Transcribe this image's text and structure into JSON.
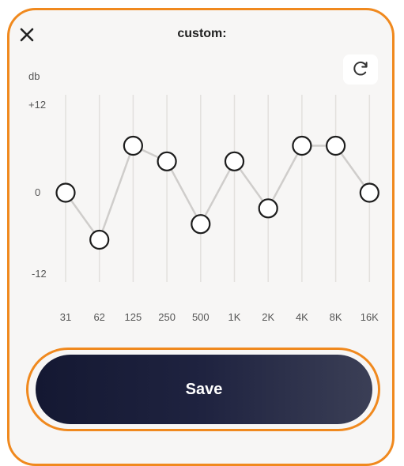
{
  "header": {
    "title": "custom:",
    "close_icon": "close-icon",
    "reset_icon": "refresh-icon"
  },
  "equalizer": {
    "unit_label": "db",
    "max_label": "+12",
    "zero_label": "0",
    "min_label": "-12",
    "range_db": [
      -12,
      12
    ],
    "bands": [
      {
        "freq": "31",
        "gain_db": 0
      },
      {
        "freq": "62",
        "gain_db": -6
      },
      {
        "freq": "125",
        "gain_db": 6
      },
      {
        "freq": "250",
        "gain_db": 4
      },
      {
        "freq": "500",
        "gain_db": -4
      },
      {
        "freq": "1K",
        "gain_db": 4
      },
      {
        "freq": "2K",
        "gain_db": -2
      },
      {
        "freq": "4K",
        "gain_db": 6
      },
      {
        "freq": "8K",
        "gain_db": 6
      },
      {
        "freq": "16K",
        "gain_db": 0
      }
    ]
  },
  "actions": {
    "save_label": "Save"
  },
  "colors": {
    "accent_outline": "#f0891e",
    "save_button": "#1a1e38"
  }
}
